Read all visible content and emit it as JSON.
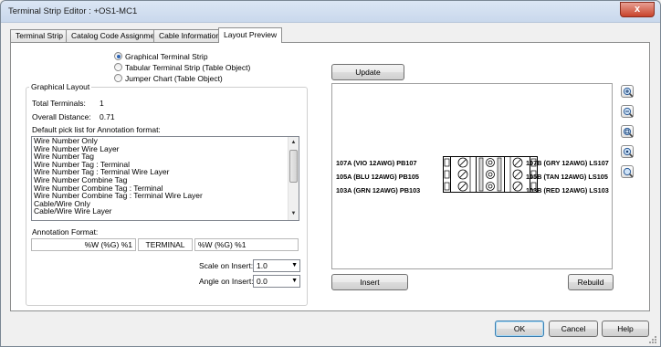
{
  "window": {
    "title": "Terminal Strip Editor : +OS1-MC1",
    "close_label": "x"
  },
  "tabs": [
    {
      "label": "Terminal Strip",
      "active": false
    },
    {
      "label": "Catalog Code Assignment",
      "active": false
    },
    {
      "label": "Cable Information",
      "active": false
    },
    {
      "label": "Layout Preview",
      "active": true
    }
  ],
  "output_type": {
    "options": [
      {
        "label": "Graphical Terminal Strip",
        "selected": true
      },
      {
        "label": "Tabular Terminal Strip (Table Object)",
        "selected": false
      },
      {
        "label": "Jumper Chart (Table Object)",
        "selected": false
      }
    ]
  },
  "graphical_layout": {
    "group_label": "Graphical Layout",
    "total_terminals_label": "Total Terminals:",
    "total_terminals_value": "1",
    "overall_distance_label": "Overall Distance:",
    "overall_distance_value": "0.71",
    "pick_list_label": "Default pick list for Annotation format:",
    "pick_list_items": [
      "Wire Number Only",
      "Wire Number Wire Layer",
      "Wire Number Tag",
      "Wire Number Tag : Terminal",
      "Wire Number Tag : Terminal Wire Layer",
      "Wire Number Combine Tag",
      "Wire Number Combine Tag : Terminal",
      "Wire Number Combine Tag : Terminal Wire Layer",
      "Cable/Wire Only",
      "Cable/Wire Wire Layer"
    ],
    "annotation_format_label": "Annotation Format:",
    "annotation_left": "%W (%G) %1",
    "annotation_middle": "TERMINAL",
    "annotation_right": "%W (%G) %1",
    "scale_label": "Scale on Insert:",
    "scale_value": "1.0",
    "angle_label": "Angle on Insert:",
    "angle_value": "0.0"
  },
  "preview": {
    "update_label": "Update",
    "insert_label": "Insert",
    "rebuild_label": "Rebuild",
    "left_labels": [
      "107A (VIO 12AWG) PB107",
      "105A (BLU 12AWG) PB105",
      "103A (GRN 12AWG) PB103"
    ],
    "right_labels": [
      "107B (GRY 12AWG) LS107",
      "105B (TAN 12AWG) LS105",
      "103B (RED 12AWG) LS103"
    ],
    "zoom_icons": [
      "zoom-in-icon",
      "zoom-out-icon",
      "zoom-window-icon",
      "zoom-extents-icon",
      "zoom-realtime-icon"
    ]
  },
  "footer": {
    "ok_label": "OK",
    "cancel_label": "Cancel",
    "help_label": "Help"
  },
  "colors": {
    "titlebar": "#c9d8ec",
    "close": "#c8432b",
    "default_button_border": "#3c7fb1"
  }
}
